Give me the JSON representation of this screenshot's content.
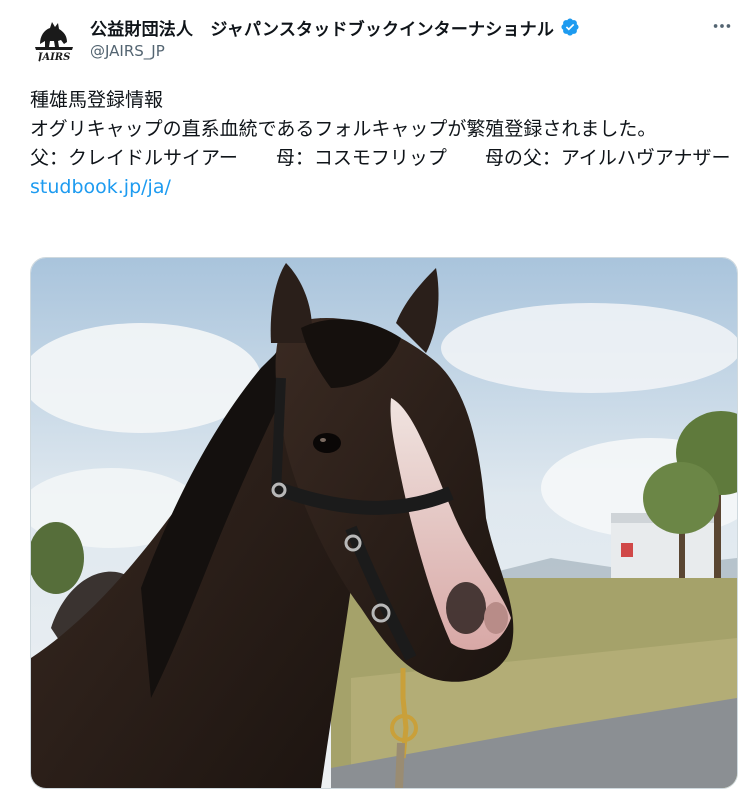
{
  "author": {
    "display_name": "公益財団法人　ジャパンスタッドブックインターナショナル",
    "handle": "@JAIRS_JP",
    "verified": true,
    "avatar_logo_text": "JAIRS",
    "avatar_icon": "horse-silhouette-logo-icon",
    "verified_icon": "verified-badge-icon",
    "verified_color": "#1d9bf0"
  },
  "menu": {
    "more_icon": "more-horizontal-icon"
  },
  "tweet": {
    "line1": "種雄馬登録情報",
    "line2": "オグリキャップの直系血統であるフォルキャップが繁殖登録されました。",
    "line3": "父：クレイドルサイアー　　母：コスモフリップ　　母の父：アイルハヴアナザー",
    "link": "studbook.jp/ja/",
    "link_color": "#1d9bf0"
  },
  "media": {
    "type": "photo",
    "subject": "horse-photo"
  }
}
